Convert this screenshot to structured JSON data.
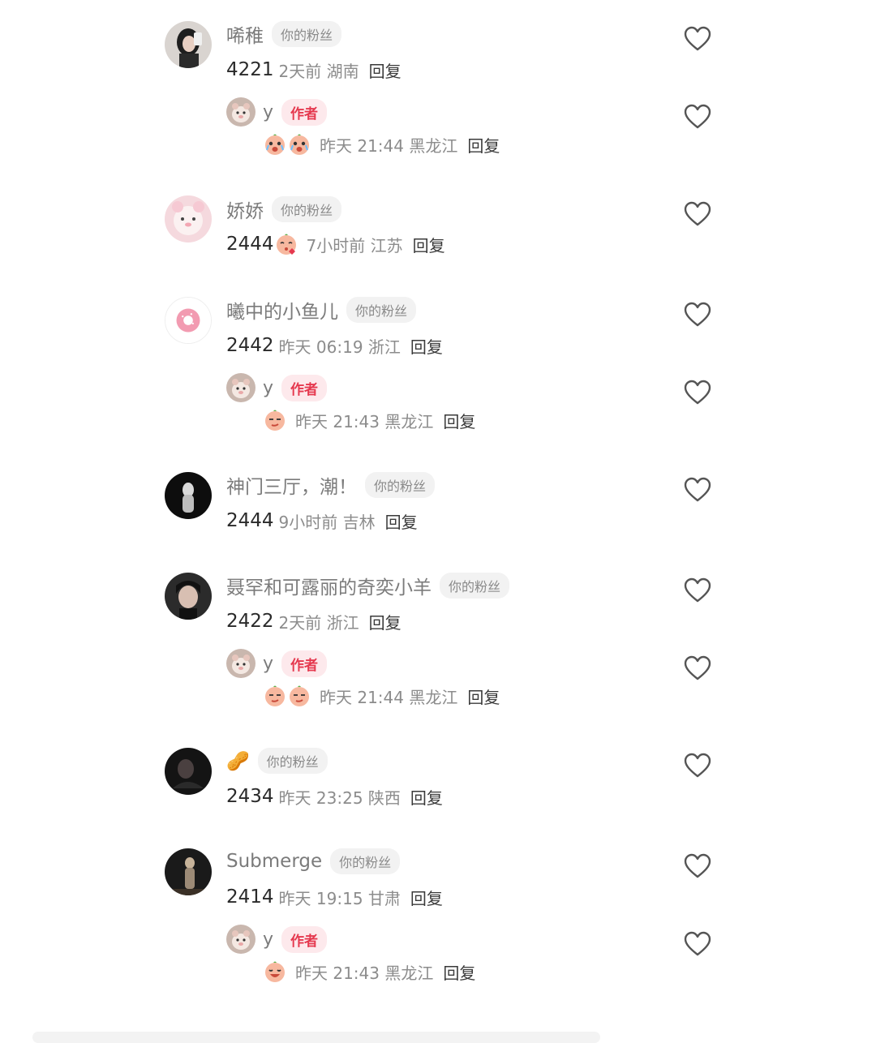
{
  "fan_badge": "你的粉丝",
  "author_badge": "作者",
  "reply_label": "回复",
  "colors": {
    "author_badge_text": "#e5394f",
    "author_badge_bg": "#fde9ec",
    "fan_badge_bg": "#f2f2f2"
  },
  "comments": [
    {
      "name": "唏稚",
      "avatar": "girl-photo",
      "text": "4221",
      "text_emoji": null,
      "time": "2天前 湖南",
      "replies": [
        {
          "name": "y",
          "emojis": [
            "crying-peach",
            "crying-peach"
          ],
          "time": "昨天 21:44 黑龙江"
        }
      ]
    },
    {
      "name": "娇娇",
      "avatar": "pink-plush",
      "text": "2444",
      "text_emoji": "kissing-peach",
      "time": "7小时前 江苏",
      "replies": []
    },
    {
      "name": "曦中的小鱼儿",
      "avatar": "donut",
      "text": "2442",
      "text_emoji": null,
      "time": "昨天 06:19 浙江",
      "replies": [
        {
          "name": "y",
          "emojis": [
            "smirk-peach"
          ],
          "time": "昨天 21:43 黑龙江"
        }
      ]
    },
    {
      "name": "神门三厅，潮！",
      "avatar": "dark-figure",
      "text": "2444",
      "text_emoji": null,
      "time": "9小时前 吉林",
      "replies": []
    },
    {
      "name": "聂罕和可露丽的奇奕小羊",
      "avatar": "boy-photo",
      "text": "2422",
      "text_emoji": null,
      "time": "2天前 浙江",
      "replies": [
        {
          "name": "y",
          "emojis": [
            "smirk-peach",
            "smirk-peach"
          ],
          "time": "昨天 21:44 黑龙江"
        }
      ]
    },
    {
      "name": "🥜",
      "avatar": "dark-portrait",
      "text": "2434",
      "text_emoji": null,
      "time": "昨天 23:25 陕西",
      "replies": []
    },
    {
      "name": "Submerge",
      "avatar": "night-figure",
      "text": "2414",
      "text_emoji": null,
      "time": "昨天 19:15 甘肃",
      "replies": [
        {
          "name": "y",
          "emojis": [
            "laughing-peach"
          ],
          "time": "昨天 21:43 黑龙江"
        }
      ]
    }
  ]
}
